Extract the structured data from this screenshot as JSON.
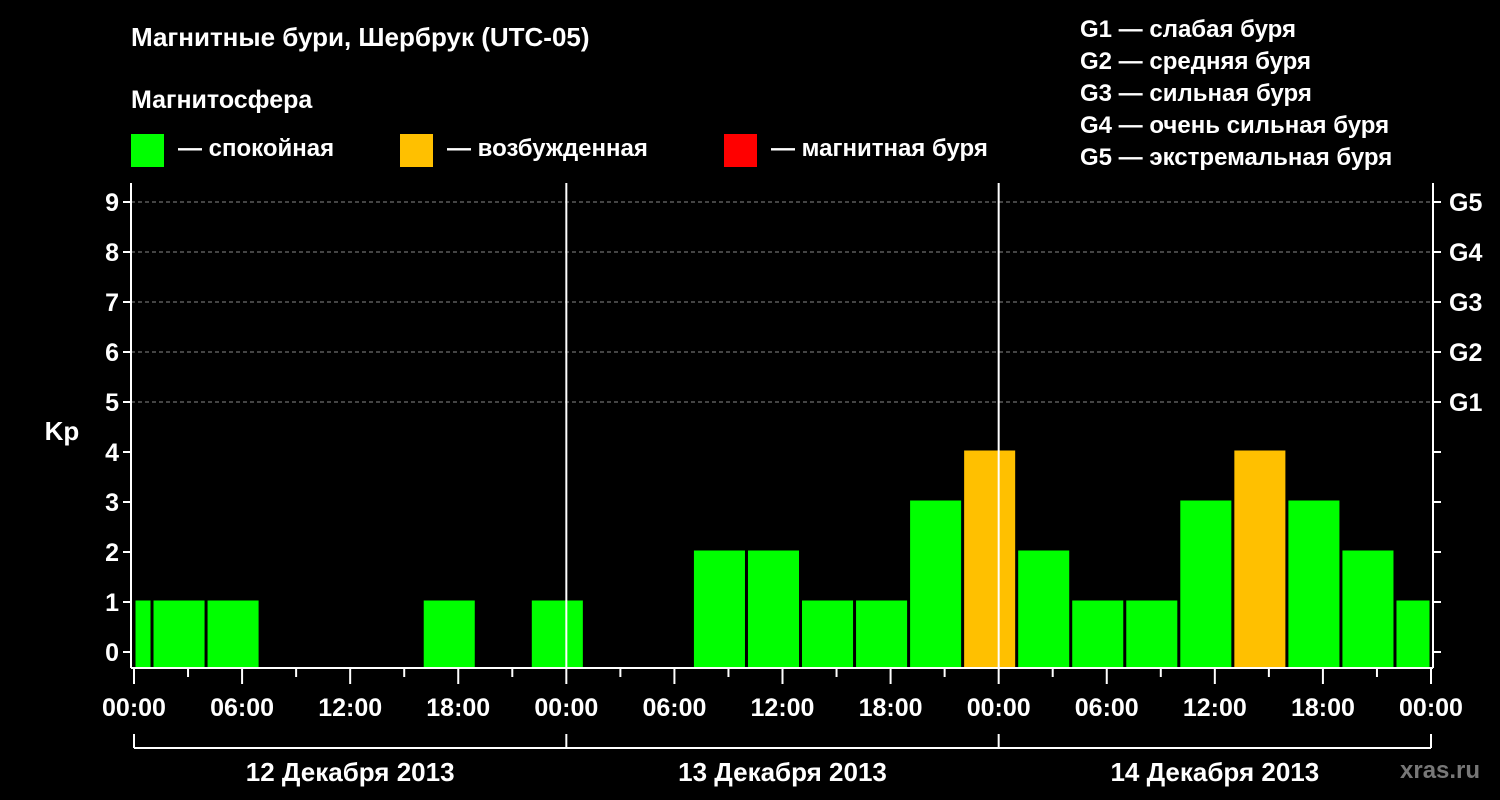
{
  "header": {
    "title": "Магнитные бури, Шербрук (UTC-05)",
    "subtitle": "Магнитосфера"
  },
  "legend": [
    {
      "label": "— спокойная",
      "color": "#00ff00"
    },
    {
      "label": "— возбужденная",
      "color": "#ffc000"
    },
    {
      "label": "— магнитная буря",
      "color": "#ff0000"
    }
  ],
  "g_scale": [
    "G1 — слабая буря",
    "G2 — средняя буря",
    "G3 — сильная буря",
    "G4 — очень сильная буря",
    "G5 — экстремальная буря"
  ],
  "watermark": "xras.ru",
  "chart_data": {
    "type": "bar",
    "ylabel": "Kp",
    "ylim": [
      0,
      9
    ],
    "y_ticks": [
      0,
      1,
      2,
      3,
      4,
      5,
      6,
      7,
      8,
      9
    ],
    "right_ticks": [
      {
        "value": 5,
        "label": "G1"
      },
      {
        "value": 6,
        "label": "G2"
      },
      {
        "value": 7,
        "label": "G3"
      },
      {
        "value": 8,
        "label": "G4"
      },
      {
        "value": 9,
        "label": "G5"
      }
    ],
    "x_tick_labels": [
      "00:00",
      "06:00",
      "12:00",
      "18:00",
      "00:00",
      "06:00",
      "12:00",
      "18:00",
      "00:00",
      "06:00",
      "12:00",
      "18:00",
      "00:00"
    ],
    "days": [
      "12 Декабря 2013",
      "13 Декабря 2013",
      "14 Декабря 2013"
    ],
    "colors": {
      "quiet": "#00ff00",
      "active": "#ffc000",
      "storm": "#ff0000"
    },
    "bars": [
      {
        "start": 0.0,
        "end": 1.0,
        "kp": 1,
        "state": "quiet"
      },
      {
        "start": 1.0,
        "end": 4.0,
        "kp": 1,
        "state": "quiet"
      },
      {
        "start": 4.0,
        "end": 7.0,
        "kp": 1,
        "state": "quiet"
      },
      {
        "start": 7.0,
        "end": 10.0,
        "kp": 0,
        "state": "quiet"
      },
      {
        "start": 10.0,
        "end": 13.0,
        "kp": 0,
        "state": "quiet"
      },
      {
        "start": 13.0,
        "end": 16.0,
        "kp": 0,
        "state": "quiet"
      },
      {
        "start": 16.0,
        "end": 19.0,
        "kp": 1,
        "state": "quiet"
      },
      {
        "start": 19.0,
        "end": 22.0,
        "kp": 0,
        "state": "quiet"
      },
      {
        "start": 22.0,
        "end": 25.0,
        "kp": 1,
        "state": "quiet"
      },
      {
        "start": 25.0,
        "end": 28.0,
        "kp": 0,
        "state": "quiet"
      },
      {
        "start": 28.0,
        "end": 31.0,
        "kp": 0,
        "state": "quiet"
      },
      {
        "start": 31.0,
        "end": 34.0,
        "kp": 2,
        "state": "quiet"
      },
      {
        "start": 34.0,
        "end": 37.0,
        "kp": 2,
        "state": "quiet"
      },
      {
        "start": 37.0,
        "end": 40.0,
        "kp": 1,
        "state": "quiet"
      },
      {
        "start": 40.0,
        "end": 43.0,
        "kp": 1,
        "state": "quiet"
      },
      {
        "start": 43.0,
        "end": 46.0,
        "kp": 3,
        "state": "quiet"
      },
      {
        "start": 46.0,
        "end": 49.0,
        "kp": 4,
        "state": "active"
      },
      {
        "start": 49.0,
        "end": 52.0,
        "kp": 2,
        "state": "quiet"
      },
      {
        "start": 52.0,
        "end": 55.0,
        "kp": 1,
        "state": "quiet"
      },
      {
        "start": 55.0,
        "end": 58.0,
        "kp": 1,
        "state": "quiet"
      },
      {
        "start": 58.0,
        "end": 61.0,
        "kp": 3,
        "state": "quiet"
      },
      {
        "start": 61.0,
        "end": 64.0,
        "kp": 4,
        "state": "active"
      },
      {
        "start": 64.0,
        "end": 67.0,
        "kp": 3,
        "state": "quiet"
      },
      {
        "start": 67.0,
        "end": 70.0,
        "kp": 2,
        "state": "quiet"
      },
      {
        "start": 70.0,
        "end": 72.0,
        "kp": 1,
        "state": "quiet"
      }
    ]
  }
}
